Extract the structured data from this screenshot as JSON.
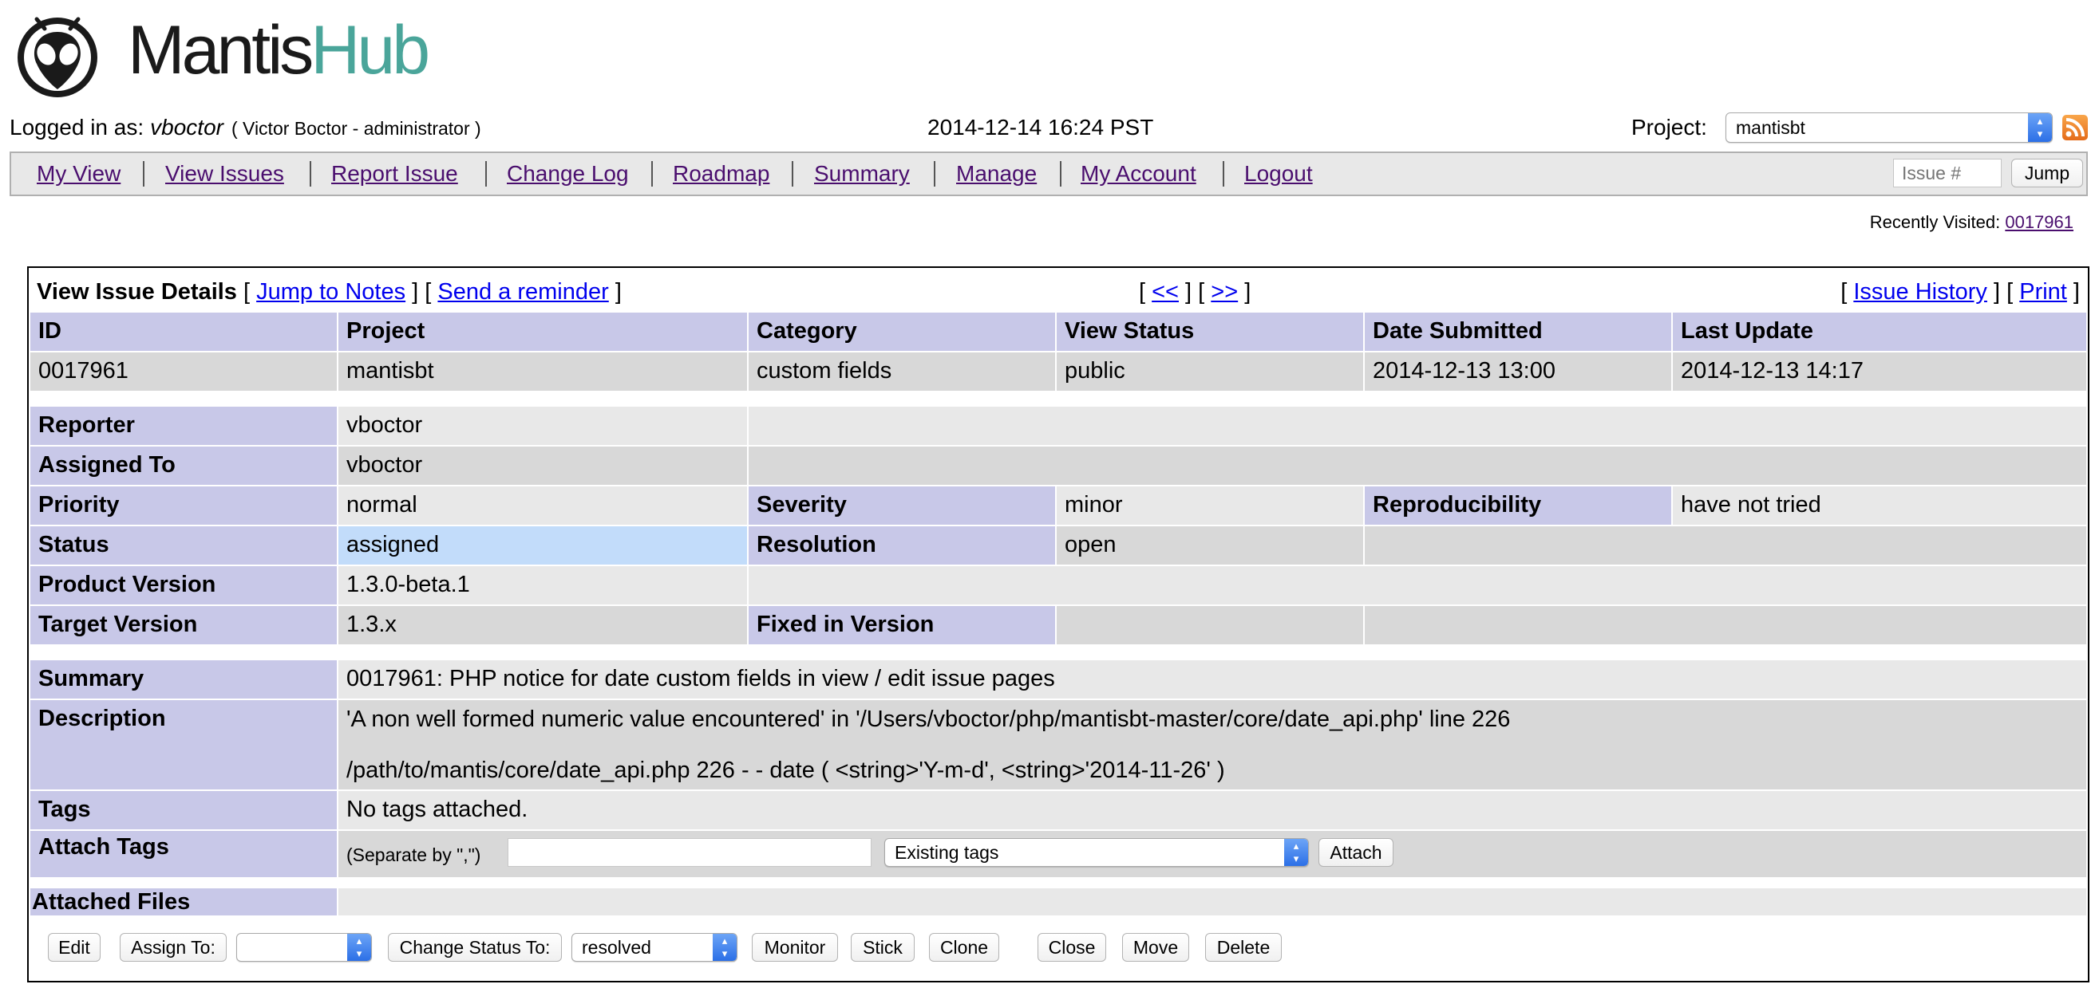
{
  "brand": {
    "name_part1": "Mantis",
    "name_part2": "Hub"
  },
  "header": {
    "logged_in_label": "Logged in as:",
    "username": "vboctor",
    "user_full": "( Victor Boctor - administrator )",
    "datetime": "2014-12-14 16:24 PST",
    "project_label": "Project:",
    "project_value": "mantisbt"
  },
  "menu": {
    "items": [
      "My View",
      "View Issues",
      "Report Issue",
      "Change Log",
      "Roadmap",
      "Summary",
      "Manage",
      "My Account",
      "Logout"
    ],
    "issue_placeholder": "Issue #",
    "jump_label": "Jump"
  },
  "recently_visited": {
    "label": "Recently Visited:",
    "issue": "0017961"
  },
  "issue": {
    "title": "View Issue Details",
    "jump_to_notes": "Jump to Notes",
    "send_reminder": "Send a reminder",
    "prev": "<<",
    "next": ">>",
    "issue_history": "Issue History",
    "print": "Print",
    "headers": [
      "ID",
      "Project",
      "Category",
      "View Status",
      "Date Submitted",
      "Last Update"
    ],
    "values": [
      "0017961",
      "mantisbt",
      "custom fields",
      "public",
      "2014-12-13 13:00",
      "2014-12-13 14:17"
    ],
    "reporter_label": "Reporter",
    "reporter": "vboctor",
    "assigned_label": "Assigned To",
    "assigned": "vboctor",
    "priority_label": "Priority",
    "priority": "normal",
    "severity_label": "Severity",
    "severity": "minor",
    "repro_label": "Reproducibility",
    "repro": "have not tried",
    "status_label": "Status",
    "status": "assigned",
    "resolution_label": "Resolution",
    "resolution": "open",
    "product_version_label": "Product Version",
    "product_version": "1.3.0-beta.1",
    "target_version_label": "Target Version",
    "target_version": "1.3.x",
    "fixed_label": "Fixed in Version",
    "summary_label": "Summary",
    "summary": "0017961: PHP notice for date custom fields in view / edit issue pages",
    "description_label": "Description",
    "description_line1": "'A non well formed numeric value encountered' in '/Users/vboctor/php/mantisbt-master/core/date_api.php' line 226",
    "description_line2": "/path/to/mantis/core/date_api.php 226 - - date ( <string>'Y-m-d', <string>'2014-11-26' )",
    "tags_label": "Tags",
    "tags": "No tags attached.",
    "attach_tags_label": "Attach Tags",
    "separate_hint": "(Separate by \",\")",
    "existing_tags": "Existing tags",
    "attach_btn": "Attach",
    "attached_files_label": "Attached Files"
  },
  "actions": {
    "edit": "Edit",
    "assign_to": "Assign To:",
    "change_status": "Change Status To:",
    "status_option": "resolved",
    "monitor": "Monitor",
    "stick": "Stick",
    "clone": "Clone",
    "close": "Close",
    "move": "Move",
    "delete": "Delete"
  },
  "colors": {
    "header_cell": "#c8c8e8",
    "row_dark": "#d8d8d8",
    "row_light": "#e8e8e8",
    "status_assigned": "#c2dcfa",
    "menu_link": "#4a0e6e",
    "brand_accent": "#4aa59a"
  }
}
